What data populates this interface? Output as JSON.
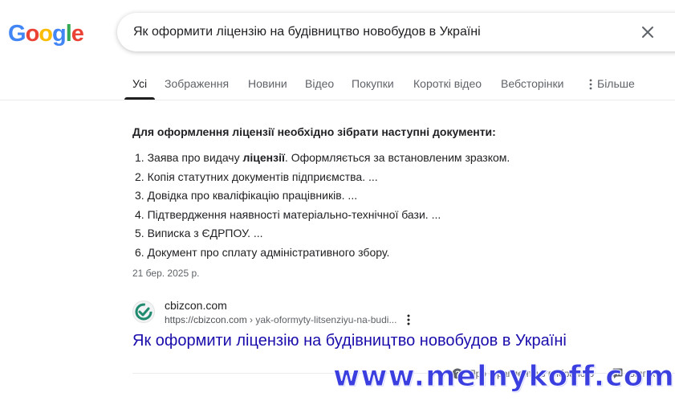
{
  "logo": {
    "letters": [
      "G",
      "o",
      "o",
      "g",
      "l",
      "e"
    ],
    "colors": [
      "#4285F4",
      "#EA4335",
      "#FBBC05",
      "#4285F4",
      "#34A853",
      "#EA4335"
    ]
  },
  "search": {
    "query": "Як оформити ліцензію на будівництво новобудов в Україні"
  },
  "tabs": [
    {
      "label": "Усі",
      "active": true
    },
    {
      "label": "Зображення"
    },
    {
      "label": "Новини"
    },
    {
      "label": "Відео"
    },
    {
      "label": "Покупки"
    },
    {
      "label": "Короткі відео"
    },
    {
      "label": "Вебсторінки"
    },
    {
      "label": "Більше"
    }
  ],
  "answer": {
    "title": "Для оформлення ліцензії необхідно зібрати наступні документи:",
    "items": [
      {
        "num": "1.",
        "pre": "Заява про видачу ",
        "bold": "ліцензії",
        "post": ". Оформляється за встановленим зразком."
      },
      {
        "num": "2.",
        "pre": "Копія статутних документів підприємства. ...",
        "bold": "",
        "post": ""
      },
      {
        "num": "3.",
        "pre": "Довідка про кваліфікацію працівників. ...",
        "bold": "",
        "post": ""
      },
      {
        "num": "4.",
        "pre": "Підтвердження наявності матеріально-технічної бази. ...",
        "bold": "",
        "post": ""
      },
      {
        "num": "5.",
        "pre": "Виписка з ЄДРПОУ. ...",
        "bold": "",
        "post": ""
      },
      {
        "num": "6.",
        "pre": "Документ про сплату адміністративного збору.",
        "bold": "",
        "post": ""
      }
    ],
    "date": "21 бер. 2025 р."
  },
  "result": {
    "site_name": "cbizcon.com",
    "url_base": "https://cbizcon.com",
    "url_path": " › yak-oformyty-litsenziyu-na-budi...",
    "title": "Як оформити ліцензію на будівництво новобудов в Україні"
  },
  "footer": {
    "about": "Про фрагменти з вибраного",
    "feedback": "Відгук"
  },
  "watermark": "www.melnykoff.com"
}
